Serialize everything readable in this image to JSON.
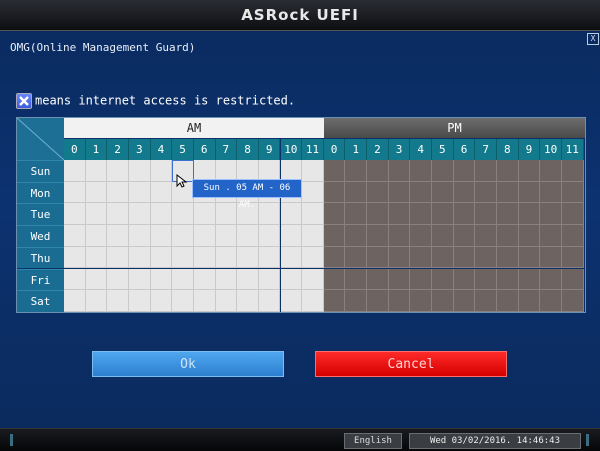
{
  "header": {
    "brand": "ASRock UEFI"
  },
  "window": {
    "title": "OMG(Online Management Guard)",
    "close_label": "X"
  },
  "legend": {
    "text": "means internet access is restricted."
  },
  "schedule": {
    "am_label": "AM",
    "pm_label": "PM",
    "hours_am": [
      "0",
      "1",
      "2",
      "3",
      "4",
      "5",
      "6",
      "7",
      "8",
      "9",
      "10",
      "11"
    ],
    "hours_pm": [
      "0",
      "1",
      "2",
      "3",
      "4",
      "5",
      "6",
      "7",
      "8",
      "9",
      "10",
      "11"
    ],
    "days": [
      "Sun",
      "Mon",
      "Tue",
      "Wed",
      "Thu",
      "Fri",
      "Sat"
    ],
    "tooltip": "Sun . 05 AM - 06 AM."
  },
  "buttons": {
    "ok": "Ok",
    "cancel": "Cancel"
  },
  "footer": {
    "language": "English",
    "datetime": "Wed 03/02/2016. 14:46:43"
  }
}
